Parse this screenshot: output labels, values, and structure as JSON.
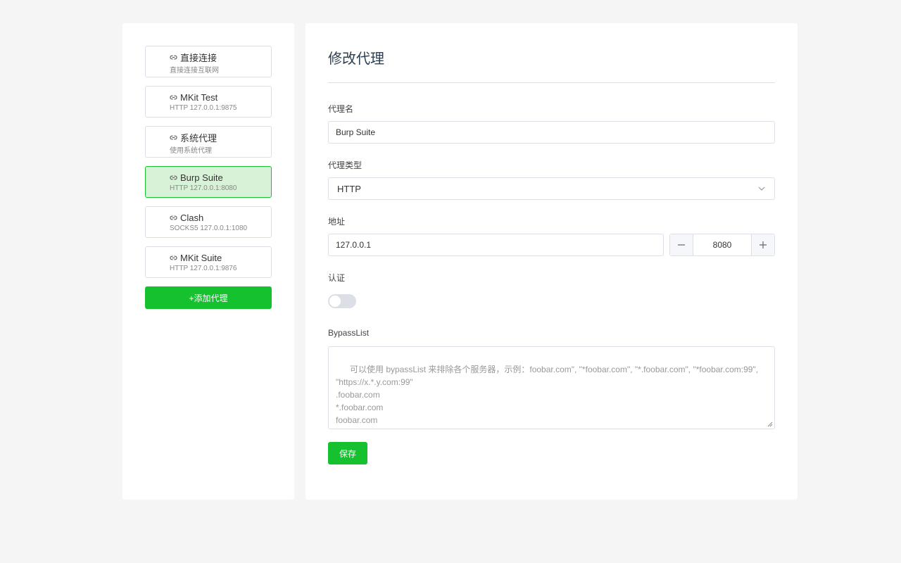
{
  "sidebar": {
    "items": [
      {
        "name": "直接连接",
        "desc": "直接连接互联网",
        "active": false
      },
      {
        "name": "MKit Test",
        "desc": "HTTP 127.0.0.1:9875",
        "active": false
      },
      {
        "name": "系统代理",
        "desc": "使用系统代理",
        "active": false
      },
      {
        "name": "Burp Suite",
        "desc": "HTTP 127.0.0.1:8080",
        "active": true
      },
      {
        "name": "Clash",
        "desc": "SOCKS5 127.0.0.1:1080",
        "active": false
      },
      {
        "name": "MKit Suite",
        "desc": "HTTP 127.0.0.1:9876",
        "active": false
      }
    ],
    "add_label": "+添加代理",
    "item_icon": "link-icon"
  },
  "form": {
    "title": "修改代理",
    "name_label": "代理名",
    "name_value": "Burp Suite",
    "type_label": "代理类型",
    "type_value": "HTTP",
    "address_label": "地址",
    "host_value": "127.0.0.1",
    "port_value": "8080",
    "auth_label": "认证",
    "auth_enabled": false,
    "bypass_label": "BypassList",
    "bypass_placeholder": "可以使用 bypassList 来排除各个服务器，示例：foobar.com\", \"*foobar.com\", \"*.foobar.com\", \"*foobar.com:99\",\n\"https://x.*.y.com:99\"\n.foobar.com\n*.foobar.com\nfoobar.com\n*foobar.com",
    "save_label": "保存"
  },
  "colors": {
    "accent": "#15c12e",
    "active_bg": "#d8f2d8",
    "border": "#dcdfe6",
    "page_bg": "#f5f5f5"
  }
}
